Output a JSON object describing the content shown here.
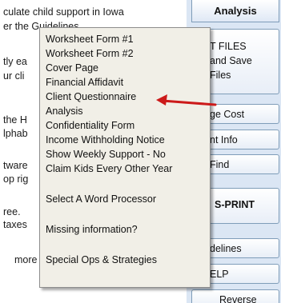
{
  "background_text": [
    "culate child support in Iowa",
    "er the Guidelines",
    "tly ea",
    "ur cli",
    "the H",
    "lphab",
    "tware",
    "op rig",
    "ree.",
    "taxes",
    "more"
  ],
  "right_panel": {
    "header": "Analysis",
    "buttons": [
      {
        "id": "files",
        "lines": [
          "T FILES",
          "and Save",
          "Files"
        ]
      },
      {
        "id": "cost",
        "lines": [
          "ge Cost"
        ]
      },
      {
        "id": "info",
        "lines": [
          "nt Info"
        ]
      },
      {
        "id": "find",
        "lines": [
          "Find"
        ]
      },
      {
        "id": "sprint",
        "lines": [
          "S-PRINT"
        ]
      },
      {
        "id": "guidelines",
        "lines": [
          "delines"
        ]
      },
      {
        "id": "help",
        "lines": [
          "ELP"
        ]
      },
      {
        "id": "reverse",
        "lines": [
          "Reverse"
        ]
      }
    ]
  },
  "menu": {
    "items": [
      "Worksheet Form #1",
      "Worksheet Form #2",
      "Cover Page",
      "Financial Affidavit",
      "Client Questionnaire",
      "Analysis",
      "Confidentiality Form",
      "Income Withholding Notice",
      "Show Weekly Support - No",
      "Claim Kids Every Other Year",
      "Select A Word Processor",
      "Missing information?",
      "Special Ops & Strategies"
    ]
  },
  "colors": {
    "arrow": "#cc1a1a",
    "menu_bg": "#f1efe7",
    "panel_bg": "#dbe6f4"
  },
  "icons": {
    "arrow": "left-arrow-icon"
  }
}
